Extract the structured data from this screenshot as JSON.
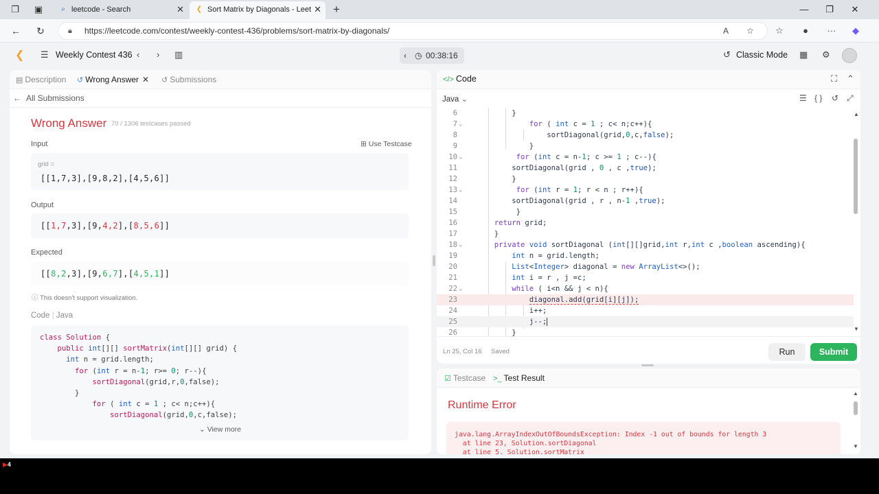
{
  "browser": {
    "tabs": [
      {
        "title": "leetcode - Search",
        "active": false
      },
      {
        "title": "Sort Matrix by Diagonals - LeetCo",
        "active": true
      }
    ],
    "url": "https://leetcode.com/contest/weekly-contest-436/problems/sort-matrix-by-diagonals/"
  },
  "header": {
    "contest": "Weekly Contest 436",
    "timer": "00:38:16",
    "mode": "Classic Mode"
  },
  "left": {
    "tabs": {
      "description": "Description",
      "wrong": "Wrong Answer",
      "submissions": "Submissions"
    },
    "back": "All Submissions",
    "status": "Wrong Answer",
    "passed": "70 / 1306 testcases passed",
    "input_label": "Input",
    "use_testcase": "Use Testcase",
    "grid_label": "grid =",
    "input_value": "[[1,7,3],[9,8,2],[4,5,6]]",
    "output_label": "Output",
    "output_value": "[[1,7,3],[9,4,2],[8,5,6]]",
    "expected_label": "Expected",
    "expected_value": "[[8,2,3],[9,6,7],[4,5,1]]",
    "visual_note": "This doesn't support visualization.",
    "code_label": "Code",
    "code_lang": "Java",
    "code": [
      "class Solution {",
      "    public int[][] sortMatrix(int[][] grid) {",
      "      int n = grid.length;",
      "        for (int r = n-1; r>= 0; r--){",
      "            sortDiagonal(grid,r,0,false);",
      "        }",
      "            for ( int c = 1 ; c< n;c++){",
      "                sortDiagonal(grid,0,c,false);"
    ],
    "view_more": "View more"
  },
  "editor": {
    "title": "Code",
    "language": "Java",
    "lines": [
      {
        "n": "6",
        "t": "      }"
      },
      {
        "n": "7",
        "t": "          for ( int c = 1 ; c< n;c++){"
      },
      {
        "n": "8",
        "t": "              sortDiagonal(grid,0,c,false);"
      },
      {
        "n": "9",
        "t": "          }"
      },
      {
        "n": "10",
        "t": "       for (int c = n-1; c >= 1 ; c--){"
      },
      {
        "n": "11",
        "t": "      sortDiagonal(grid , 0 , c ,true);"
      },
      {
        "n": "12",
        "t": "      }"
      },
      {
        "n": "13",
        "t": "       for (int r = 1; r < n ; r++){"
      },
      {
        "n": "14",
        "t": "      sortDiagonal(grid , r , n-1 ,true);"
      },
      {
        "n": "15",
        "t": "       }"
      },
      {
        "n": "16",
        "t": "  return grid;"
      },
      {
        "n": "17",
        "t": "  }"
      },
      {
        "n": "18",
        "t": "  private void sortDiagonal (int[][]grid,int r,int c ,boolean ascending){"
      },
      {
        "n": "19",
        "t": "      int n = grid.length;"
      },
      {
        "n": "20",
        "t": "      List<Integer> diagonal = new ArrayList<>();"
      },
      {
        "n": "21",
        "t": "      int i = r , j =c;"
      },
      {
        "n": "22",
        "t": "      while ( i<n && j < n){"
      },
      {
        "n": "23",
        "t": "          diagonal.add(grid[i][j]);"
      },
      {
        "n": "24",
        "t": "          i++;"
      },
      {
        "n": "25",
        "t": "          j--;"
      },
      {
        "n": "26",
        "t": "      }"
      }
    ],
    "cursor": "Ln 25, Col 16",
    "saved": "Saved",
    "run": "Run",
    "submit": "Submit"
  },
  "result": {
    "tabs": {
      "testcase": "Testcase",
      "result": "Test Result"
    },
    "title": "Runtime Error",
    "trace": [
      "java.lang.ArrayIndexOutOfBoundsException: Index -1 out of bounds for length 3",
      "  at line 23, Solution.sortDiagonal",
      "  at line 5, Solution.sortMatrix"
    ]
  },
  "taskbar": {
    "badge": "4"
  },
  "colors": {
    "accent_green": "#2db55d",
    "error_red": "#d9363e",
    "brand_orange": "#f7a030"
  }
}
